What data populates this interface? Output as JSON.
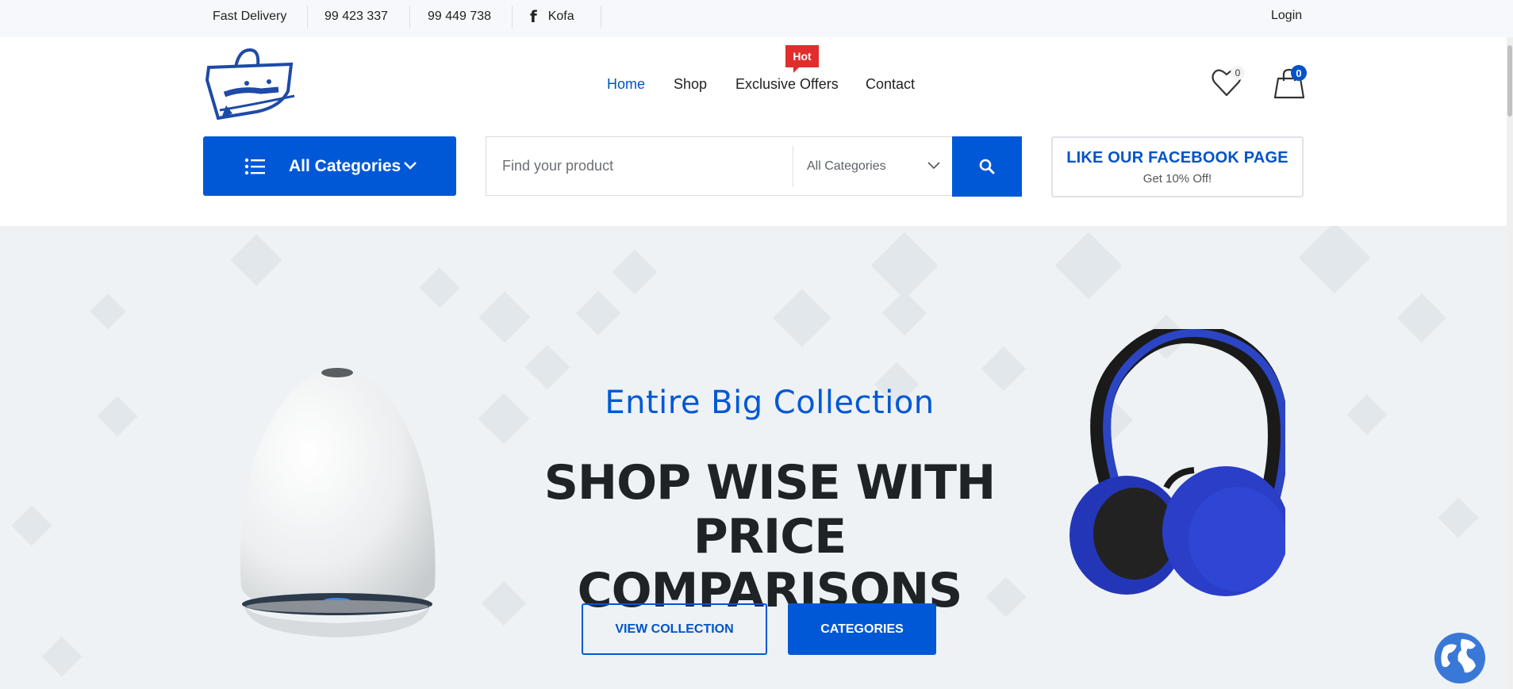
{
  "topbar": {
    "delivery": "Fast Delivery",
    "phone1": "99 423 337",
    "phone2": "99 449 738",
    "facebook_label": "Kofa",
    "login": "Login"
  },
  "nav": {
    "items": [
      {
        "label": "Home",
        "active": true
      },
      {
        "label": "Shop"
      },
      {
        "label": "Exclusive Offers"
      },
      {
        "label": "Contact"
      }
    ],
    "hot_badge": "Hot"
  },
  "header": {
    "wishlist_count": "0",
    "cart_count": "0"
  },
  "categories_button": {
    "label": "All Categories"
  },
  "search": {
    "placeholder": "Find your product",
    "category_selected": "All Categories"
  },
  "promo": {
    "title": "LIKE OUR FACEBOOK PAGE",
    "subtitle": "Get 10% Off!"
  },
  "hero": {
    "subtitle": "Entire Big Collection",
    "title_line1": "SHOP WISE WITH PRICE",
    "title_line2": "COMPARISONS",
    "btn_collection": "VIEW COLLECTION",
    "btn_categories": "CATEGORIES"
  },
  "colors": {
    "primary": "#0058d6",
    "hot": "#e02d2d",
    "hero_bg": "#eef2f4",
    "title_dark": "#202326"
  },
  "icons": {
    "facebook": "facebook-icon",
    "wishlist": "heart-icon",
    "cart": "shopping-bag-icon",
    "categories": "list-icon",
    "search": "search-icon",
    "translate": "globe-icon"
  }
}
